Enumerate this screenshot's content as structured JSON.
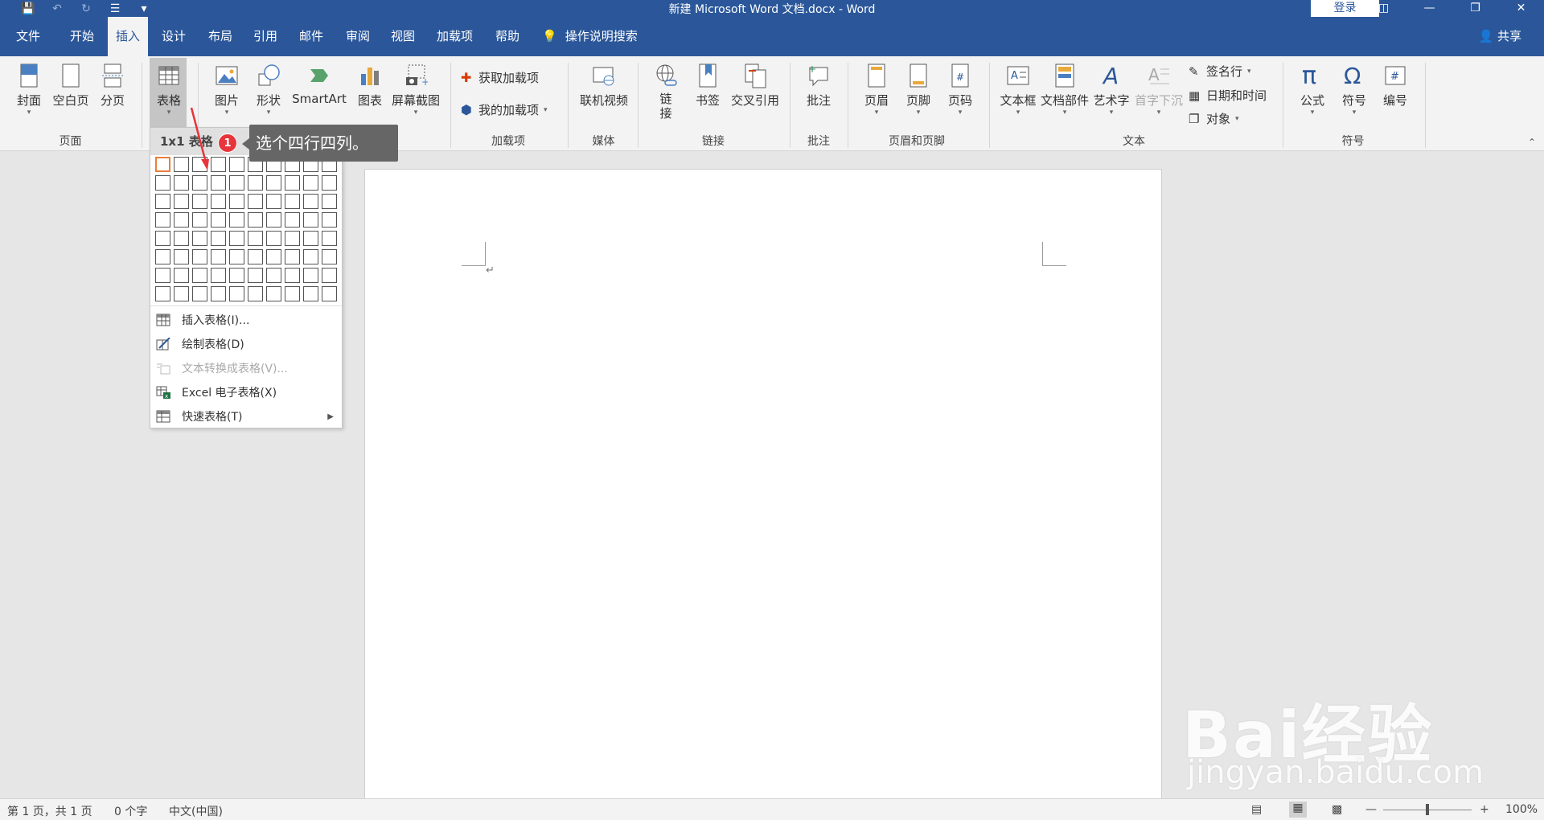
{
  "title_bar": {
    "document_title": "新建 Microsoft Word 文档.docx  -  Word",
    "login_label": "登录",
    "qat_icons": [
      "save-icon",
      "undo-icon",
      "redo-icon",
      "customize-icon"
    ],
    "window_buttons": [
      "ribbon-display-icon",
      "minimize-icon",
      "restore-icon",
      "close-icon"
    ]
  },
  "tabs": [
    "文件",
    "开始",
    "插入",
    "设计",
    "布局",
    "引用",
    "邮件",
    "审阅",
    "视图",
    "加载项",
    "帮助"
  ],
  "active_tab": "插入",
  "tell_me": "操作说明搜索",
  "share": "共享",
  "ribbon": {
    "pages_group": {
      "label": "页面",
      "cover": "封面",
      "blank": "空白页",
      "break": "分页"
    },
    "tables_group": {
      "table": "表格"
    },
    "illustrations": {
      "picture": "图片",
      "shapes": "形状",
      "smartart": "SmartArt",
      "chart": "图表",
      "screenshot": "屏幕截图"
    },
    "addins_group": {
      "label": "加载项",
      "get": "获取加载项",
      "my": "我的加载项"
    },
    "media_group": {
      "label": "媒体",
      "video": "联机视频"
    },
    "links_group": {
      "label": "链接",
      "link": "链接",
      "bookmark": "书签",
      "crossref": "交叉引用"
    },
    "comments_group": {
      "label": "批注",
      "comment": "批注"
    },
    "header_footer_group": {
      "label": "页眉和页脚",
      "header": "页眉",
      "footer": "页脚",
      "page_number": "页码"
    },
    "text_group": {
      "label": "文本",
      "textbox": "文本框",
      "quickparts": "文档部件",
      "wordart": "艺术字",
      "dropcap": "首字下沉",
      "signature": "签名行",
      "datetime": "日期和时间",
      "object": "对象"
    },
    "symbols_group": {
      "label": "符号",
      "equation": "公式",
      "symbol": "符号",
      "number": "编号"
    }
  },
  "table_dropdown": {
    "header": "1x1 表格",
    "grid_cols": 10,
    "grid_rows": 8,
    "selected_rows": 1,
    "selected_cols": 1,
    "items": [
      {
        "label": "插入表格(I)...",
        "enabled": true
      },
      {
        "label": "绘制表格(D)",
        "enabled": true
      },
      {
        "label": "文本转换成表格(V)...",
        "enabled": false
      },
      {
        "label": "Excel 电子表格(X)",
        "enabled": true
      },
      {
        "label": "快速表格(T)",
        "enabled": true
      }
    ]
  },
  "annotation": {
    "step": "1",
    "text": "选个四行四列。",
    "color": "#e8343b"
  },
  "document": {
    "paragraph_mark": "↵"
  },
  "status_bar": {
    "page": "第 1 页，共 1 页",
    "words": "0 个字",
    "language": "中文(中国)",
    "zoom": "100%"
  },
  "watermark": {
    "brand": "Bai经验",
    "url": "jingyan.baidu.com"
  },
  "colors": {
    "accent": "#2b579a",
    "ribbon_bg": "#f3f3f3",
    "selection": "#e8803a"
  }
}
